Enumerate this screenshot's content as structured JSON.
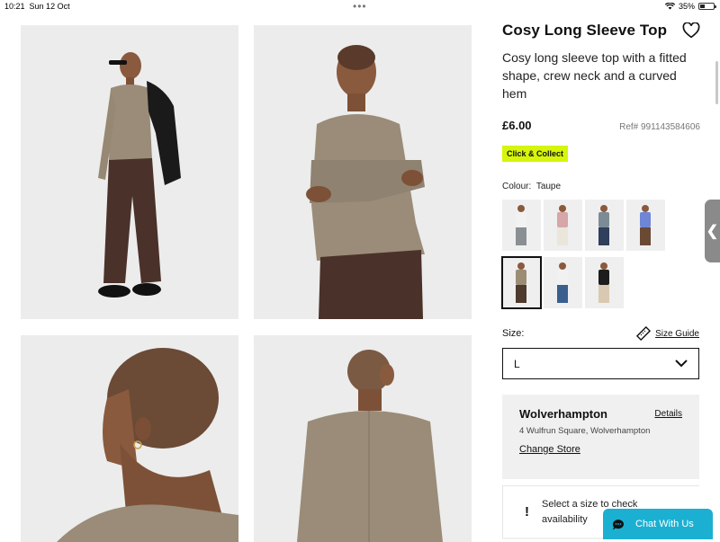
{
  "status": {
    "time": "10:21",
    "date": "Sun 12 Oct",
    "battery": "35%",
    "battery_level": 0.35
  },
  "product": {
    "title": "Cosy Long Sleeve Top",
    "description": "Cosy long sleeve top with a fitted shape, crew neck and a curved hem",
    "price": "£6.00",
    "ref": "Ref# 991143584606",
    "badge": "Click & Collect",
    "colour_label": "Colour:",
    "colour_value": "Taupe"
  },
  "swatches": [
    {
      "name": "swatch-1",
      "top": "#f2f2f2",
      "bottom": "#8a8f94",
      "selected": false
    },
    {
      "name": "swatch-2",
      "top": "#d6a6a8",
      "bottom": "#ebe6dc",
      "selected": false
    },
    {
      "name": "swatch-3",
      "top": "#7d8b96",
      "bottom": "#2f3f5c",
      "selected": false
    },
    {
      "name": "swatch-4",
      "top": "#6f86d6",
      "bottom": "#6b4a35",
      "selected": false
    },
    {
      "name": "swatch-5",
      "top": "#9b8c74",
      "bottom": "#4e3a2e",
      "selected": true
    },
    {
      "name": "swatch-6",
      "top": "#f1f1f1",
      "bottom": "#3a5f8f",
      "selected": false
    },
    {
      "name": "swatch-7",
      "top": "#1c1c1c",
      "bottom": "#d9c9b0",
      "selected": false
    }
  ],
  "size": {
    "label": "Size:",
    "guide": "Size Guide",
    "selected": "L"
  },
  "store": {
    "name": "Wolverhampton",
    "details": "Details",
    "address": "4 Wulfrun Square, Wolverhampton",
    "change": "Change Store"
  },
  "availability": {
    "line1": "Select a size to check",
    "line2": "availability"
  },
  "chat": {
    "label": "Chat With Us"
  },
  "colors": {
    "accent_badge": "#d6f50a",
    "chat": "#1bb0d2",
    "top": "#9a8c78",
    "trousers": "#4a3129"
  }
}
